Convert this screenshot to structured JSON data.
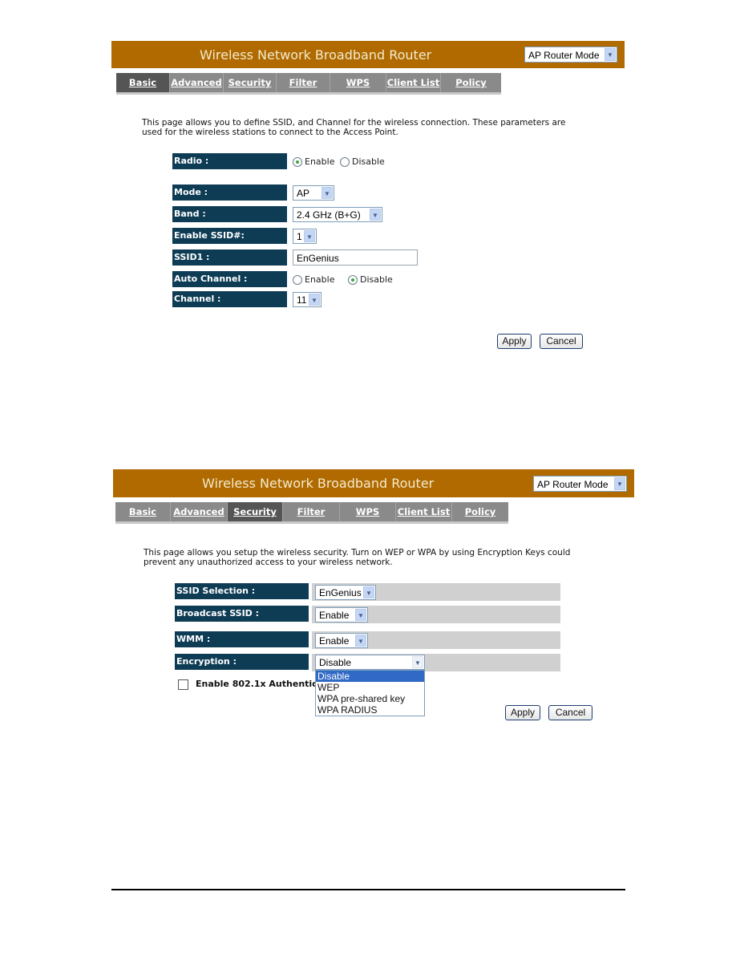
{
  "screenshot1": {
    "banner_title": "Wireless Network Broadband Router",
    "mode_select": {
      "value": "AP Router Mode"
    },
    "tabs": [
      {
        "label": "Basic",
        "active": true
      },
      {
        "label": "Advanced",
        "active": false
      },
      {
        "label": "Security",
        "active": false
      },
      {
        "label": "Filter",
        "active": false
      },
      {
        "label": "WPS",
        "active": false
      },
      {
        "label": "Client List",
        "active": false
      },
      {
        "label": "Policy",
        "active": false
      }
    ],
    "description": "This page allows you to define SSID, and Channel for the wireless connection. These parameters are used for the wireless stations to connect to the Access Point.",
    "form": {
      "radio": {
        "label": "Radio :",
        "options": [
          "Enable",
          "Disable"
        ],
        "selected": "Enable"
      },
      "mode": {
        "label": "Mode :",
        "value": "AP"
      },
      "band": {
        "label": "Band :",
        "value": "2.4 GHz (B+G)"
      },
      "enable_ssid": {
        "label": "Enable SSID#:",
        "value": "1"
      },
      "ssid1": {
        "label": "SSID1 :",
        "value": "EnGenius"
      },
      "auto_channel": {
        "label": "Auto Channel :",
        "options": [
          "Enable",
          "Disable"
        ],
        "selected": "Disable"
      },
      "channel": {
        "label": "Channel :",
        "value": "11"
      }
    },
    "buttons": {
      "apply": "Apply",
      "cancel": "Cancel"
    }
  },
  "screenshot2": {
    "banner_title": "Wireless Network Broadband Router",
    "mode_select": {
      "value": "AP Router Mode"
    },
    "tabs": [
      {
        "label": "Basic",
        "active": false
      },
      {
        "label": "Advanced",
        "active": false
      },
      {
        "label": "Security",
        "active": true
      },
      {
        "label": "Filter",
        "active": false
      },
      {
        "label": "WPS",
        "active": false
      },
      {
        "label": "Client List",
        "active": false
      },
      {
        "label": "Policy",
        "active": false
      }
    ],
    "description": "This page allows you setup the wireless security. Turn on WEP or WPA by using Encryption Keys could prevent any unauthorized access to your wireless network.",
    "form": {
      "ssid_selection": {
        "label": "SSID Selection :",
        "value": "EnGenius"
      },
      "broadcast_ssid": {
        "label": "Broadcast SSID :",
        "value": "Enable"
      },
      "wmm": {
        "label": "WMM :",
        "value": "Enable"
      },
      "encryption": {
        "label": "Encryption :",
        "value": "Disable",
        "options": [
          "Disable",
          "WEP",
          "WPA pre-shared key",
          "WPA RADIUS"
        ],
        "highlighted": "Disable"
      },
      "enable_8021x": {
        "label": "Enable 802.1x Authentication",
        "checked": false
      }
    },
    "buttons": {
      "apply": "Apply",
      "cancel": "Cancel"
    }
  },
  "colors": {
    "banner": "#b06a00",
    "tabbar": "#8a8a8a",
    "active_tab": "#555555",
    "label_bg": "#0e3c55",
    "dropdown_highlight": "#3169c6"
  }
}
